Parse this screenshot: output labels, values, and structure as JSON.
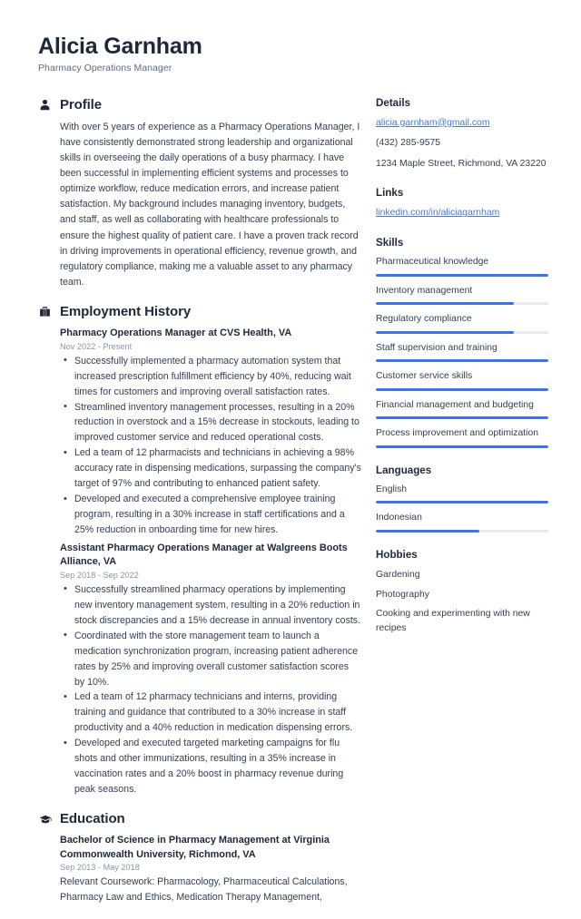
{
  "header": {
    "name": "Alicia Garnham",
    "job_title": "Pharmacy Operations Manager"
  },
  "theme": {
    "accent": "#3b72f0",
    "link": "#4a77d4",
    "heading": "#1e2838",
    "body_text": "#333e52",
    "muted": "#8a94a6",
    "bar_track": "#e7e9ee",
    "background": "#ffffff"
  },
  "sections": {
    "profile": {
      "icon": "person-icon",
      "title": "Profile",
      "text": "With over 5 years of experience as a Pharmacy Operations Manager, I have consistently demonstrated strong leadership and organizational skills in overseeing the daily operations of a busy pharmacy. I have been successful in implementing efficient systems and processes to optimize workflow, reduce medication errors, and increase patient satisfaction. My background includes managing inventory, budgets, and staff, as well as collaborating with healthcare professionals to ensure the highest quality of patient care. I have a proven track record in driving improvements in operational efficiency, revenue growth, and regulatory compliance, making me a valuable asset to any pharmacy team."
    },
    "employment": {
      "icon": "briefcase-icon",
      "title": "Employment History",
      "entries": [
        {
          "title": "Pharmacy Operations Manager at CVS Health, VA",
          "date": "Nov 2022 - Present",
          "bullets": [
            "Successfully implemented a pharmacy automation system that increased prescription fulfillment efficiency by 40%, reducing wait times for customers and improving overall satisfaction rates.",
            "Streamlined inventory management processes, resulting in a 20% reduction in overstock and a 15% decrease in stockouts, leading to improved customer service and reduced operational costs.",
            "Led a team of 12 pharmacists and technicians in achieving a 98% accuracy rate in dispensing medications, surpassing the company's target of 97% and contributing to enhanced patient safety.",
            "Developed and executed a comprehensive employee training program, resulting in a 30% increase in staff certifications and a 25% reduction in onboarding time for new hires."
          ]
        },
        {
          "title": "Assistant Pharmacy Operations Manager at Walgreens Boots Alliance, VA",
          "date": "Sep 2018 - Sep 2022",
          "bullets": [
            "Successfully streamlined pharmacy operations by implementing new inventory management system, resulting in a 20% reduction in stock discrepancies and a 15% decrease in annual inventory costs.",
            "Coordinated with the store management team to launch a medication synchronization program, increasing patient adherence rates by 25% and improving overall customer satisfaction scores by 10%.",
            "Led a team of 12 pharmacy technicians and interns, providing training and guidance that contributed to a 30% increase in staff productivity and a 40% reduction in medication dispensing errors.",
            "Developed and executed targeted marketing campaigns for flu shots and other immunizations, resulting in a 35% increase in vaccination rates and a 20% boost in pharmacy revenue during peak seasons."
          ]
        }
      ]
    },
    "education": {
      "icon": "graduation-cap-icon",
      "title": "Education",
      "entries": [
        {
          "title": "Bachelor of Science in Pharmacy Management at Virginia Commonwealth University, Richmond, VA",
          "date": "Sep 2013 - May 2018",
          "text": "Relevant Coursework: Pharmacology, Pharmaceutical Calculations, Pharmacy Law and Ethics, Medication Therapy Management,"
        }
      ]
    }
  },
  "sidebar": {
    "details": {
      "title": "Details",
      "email": "alicia.garnham@gmail.com",
      "phone": "(432) 285-9575",
      "address": "1234 Maple Street, Richmond, VA 23220"
    },
    "links": {
      "title": "Links",
      "items": [
        {
          "label": "linkedin.com/in/aliciagarnham"
        }
      ]
    },
    "skills": {
      "title": "Skills",
      "items": [
        {
          "label": "Pharmaceutical knowledge",
          "level": 100
        },
        {
          "label": "Inventory management",
          "level": 80
        },
        {
          "label": "Regulatory compliance",
          "level": 80
        },
        {
          "label": "Staff supervision and training",
          "level": 100
        },
        {
          "label": "Customer service skills",
          "level": 100
        },
        {
          "label": "Financial management and budgeting",
          "level": 100
        },
        {
          "label": "Process improvement and optimization",
          "level": 100
        }
      ]
    },
    "languages": {
      "title": "Languages",
      "items": [
        {
          "label": "English",
          "level": 100
        },
        {
          "label": "Indonesian",
          "level": 60
        }
      ]
    },
    "hobbies": {
      "title": "Hobbies",
      "items": [
        {
          "label": "Gardening"
        },
        {
          "label": "Photography"
        },
        {
          "label": "Cooking and experimenting with new recipes"
        }
      ]
    }
  }
}
